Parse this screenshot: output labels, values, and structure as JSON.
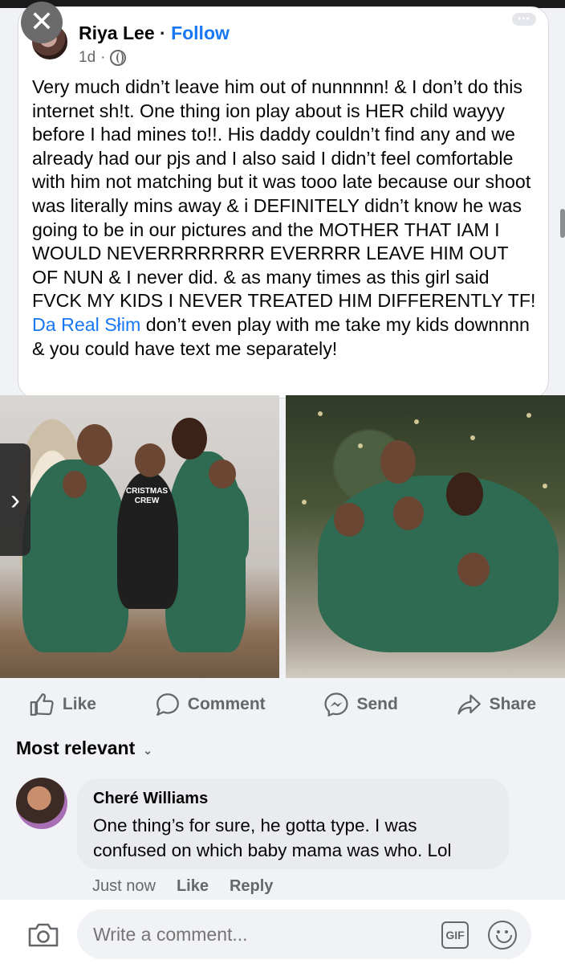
{
  "post": {
    "author": "Riya Lee",
    "separator": " · ",
    "follow_label": "Follow",
    "time": "1d",
    "time_sep": "·",
    "text_part1": "Very much didn’t leave him out of nunnnnn! & I don’t do this internet sh!t. One thing ion play about is HER child wayyy before I had mines to!!. His daddy couldn’t find any and we already had our pjs and I also said I didn’t feel comfortable with him not matching but it was tooo late because our shoot was literally mins away & i DEFINITELY didn’t  know he was going to be in our pictures and the MOTHER THAT IAM I WOULD NEVERRRRRRRR EVERRRR LEAVE HIM OUT OF NUN & I never did. & as many times as this girl said FVCK MY KIDS I NEVER TREATED HIM DIFFERENTLY TF! ",
    "mention": "Da Real Słim",
    "text_part2": " don’t even play with me take my kids downnnn & you could have text me separately!",
    "photo1_sweater_text": "CRISTMAS CREW"
  },
  "actions": {
    "like": "Like",
    "comment": "Comment",
    "send": "Send",
    "share": "Share"
  },
  "sort_label": "Most relevant",
  "comment": {
    "author": "Cheré Williams",
    "text": "One thing’s for sure, he gotta type. I was confused on which baby mama was who. Lol",
    "time": "Just now",
    "like": "Like",
    "reply": "Reply"
  },
  "composer": {
    "placeholder": "Write a comment...",
    "gif_label": "GIF"
  },
  "icons": {
    "close": "close-icon",
    "more": "more-icon",
    "globe": "globe-icon",
    "like": "thumbs-up-icon",
    "comment": "speech-bubble-icon",
    "send": "messenger-icon",
    "share": "share-arrow-icon",
    "camera": "camera-icon",
    "gif": "gif-icon",
    "emoji": "emoji-icon",
    "next": "chevron-right-icon"
  },
  "colors": {
    "accent": "#1877f2",
    "muted": "#65676b",
    "pajama_green": "#2f6a52"
  }
}
